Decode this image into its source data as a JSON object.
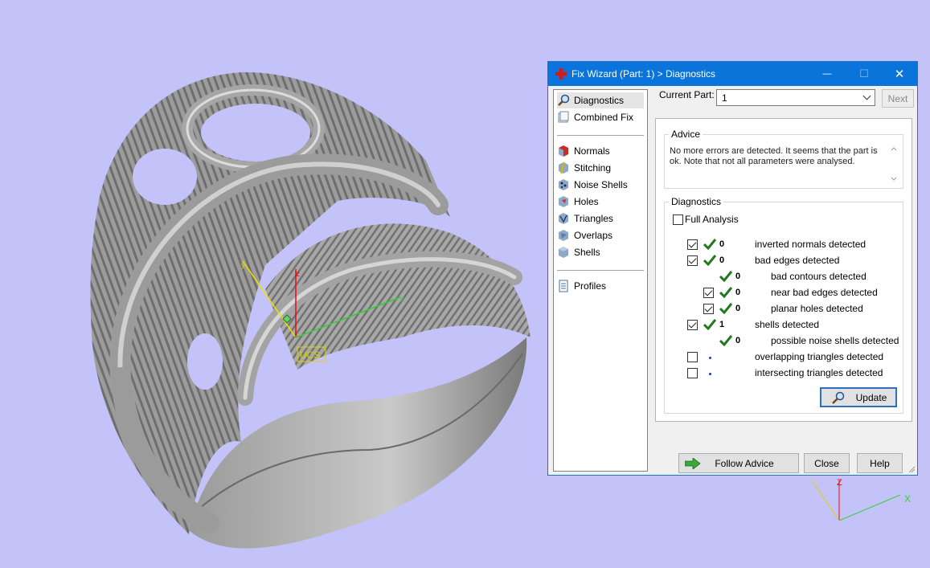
{
  "dialog": {
    "title": "Fix Wizard (Part: 1) > Diagnostics",
    "controls": {
      "minimize": "—",
      "maximize": "☐",
      "close": "✕"
    }
  },
  "sidebar": {
    "items": [
      {
        "label": "Diagnostics",
        "icon": "magnifier-icon",
        "selected": true
      },
      {
        "label": "Combined Fix",
        "icon": "combined-fix-icon"
      },
      {
        "label": "Normals",
        "icon": "normals-icon"
      },
      {
        "label": "Stitching",
        "icon": "stitching-icon"
      },
      {
        "label": "Noise Shells",
        "icon": "noise-shells-icon"
      },
      {
        "label": "Holes",
        "icon": "holes-icon"
      },
      {
        "label": "Triangles",
        "icon": "triangles-icon"
      },
      {
        "label": "Overlaps",
        "icon": "overlaps-icon"
      },
      {
        "label": "Shells",
        "icon": "shells-icon"
      },
      {
        "label": "Profiles",
        "icon": "profiles-icon"
      }
    ]
  },
  "current_part": {
    "label": "Current Part:",
    "value": "1"
  },
  "buttons": {
    "next": "Next",
    "update": "Update",
    "follow_advice": "Follow Advice",
    "close": "Close",
    "help": "Help"
  },
  "advice": {
    "title": "Advice",
    "text": "No more errors are detected. It seems that the part is ok. Note that not all parameters were analysed."
  },
  "diagnostics": {
    "title": "Diagnostics",
    "full_analysis": {
      "label": "Full Analysis",
      "checked": false
    },
    "rows": [
      {
        "text": "inverted normals detected",
        "count": "0",
        "checked": true,
        "checkbox": true,
        "status": "ok",
        "level": 0
      },
      {
        "text": "bad edges detected",
        "count": "0",
        "checked": true,
        "checkbox": true,
        "status": "ok",
        "level": 0
      },
      {
        "text": "bad contours detected",
        "count": "0",
        "checkbox": false,
        "status": "ok",
        "level": 1
      },
      {
        "text": "near bad edges detected",
        "count": "0",
        "checked": true,
        "checkbox": true,
        "status": "ok",
        "level": 1
      },
      {
        "text": "planar holes detected",
        "count": "0",
        "checked": true,
        "checkbox": true,
        "status": "ok",
        "level": 1
      },
      {
        "text": "shells detected",
        "count": "1",
        "checked": true,
        "checkbox": true,
        "status": "ok",
        "level": 0
      },
      {
        "text": "possible noise shells detected",
        "count": "0",
        "checkbox": false,
        "status": "ok",
        "level": 1
      },
      {
        "text": "overlapping triangles detected",
        "count": "",
        "checked": false,
        "checkbox": true,
        "status": "none",
        "level": 0
      },
      {
        "text": "intersecting triangles detected",
        "count": "",
        "checked": false,
        "checkbox": true,
        "status": "none",
        "level": 0
      }
    ]
  },
  "viewport": {
    "ucs_label": "UCS",
    "axes": {
      "x": "x",
      "y": "y",
      "z": "z"
    },
    "corner_axes": {
      "z": "Z",
      "x": "X"
    }
  },
  "colors": {
    "titlebar": "#0a74da",
    "background": "#c4c3f9",
    "check_green": "#1f7a1f"
  }
}
